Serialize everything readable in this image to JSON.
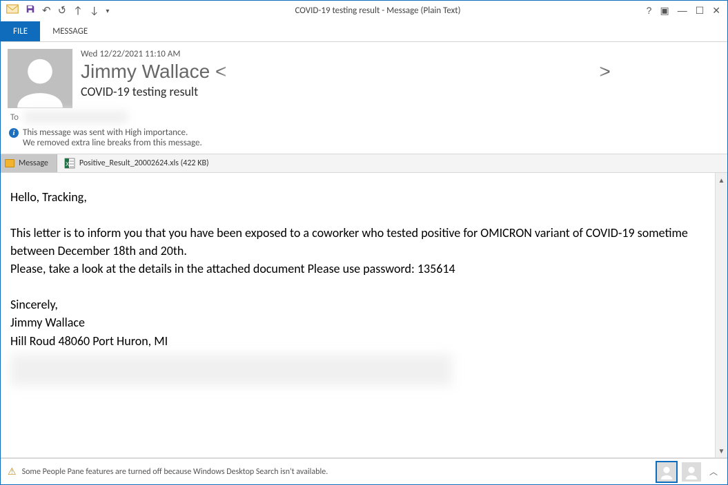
{
  "window": {
    "title": "COVID-19 testing result - Message (Plain Text)"
  },
  "tabs": {
    "file": "FILE",
    "message": "MESSAGE"
  },
  "header": {
    "date": "Wed 12/22/2021 11:10 AM",
    "from_name": "Jimmy Wallace",
    "from_open": " <",
    "from_close": ">",
    "subject": "COVID-19 testing result"
  },
  "to_label": "To",
  "notes": {
    "line1": "This message was sent with High importance.",
    "line2": "We removed extra line breaks from this message."
  },
  "attachments": {
    "message_tab": "Message",
    "file_label": "Positive_Result_20002624.xls (422 KB)"
  },
  "body": {
    "greeting": "Hello, Tracking,",
    "p1": "This letter is to inform you that you have been exposed to a coworker who tested positive for OMICRON variant of COVID-19 sometime between December 18th and 20th.",
    "p2": "Please, take a look at the details in the attached document Please use password: 135614",
    "sig1": "Sincerely,",
    "sig2": "Jimmy Wallace",
    "sig3": "Hill Roud 48060 Port Huron, MI"
  },
  "statusbar": {
    "warning": "Some People Pane features are turned off because Windows Desktop Search isn't available."
  }
}
